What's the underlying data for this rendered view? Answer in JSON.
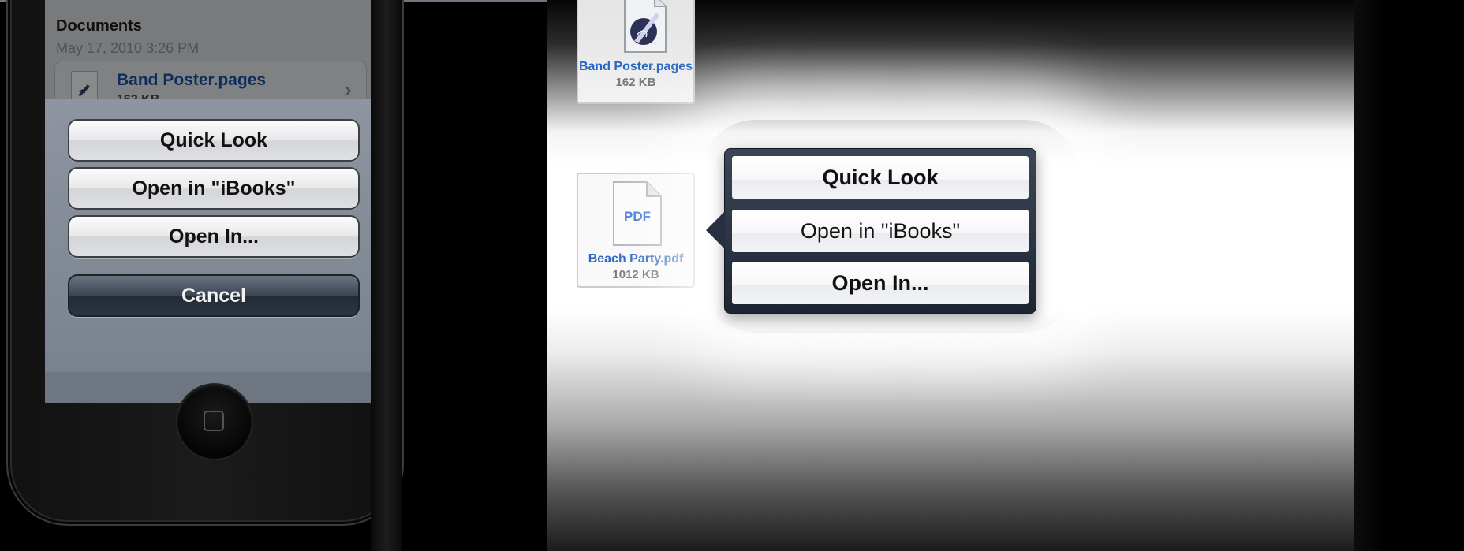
{
  "iphone": {
    "section_title": "Documents",
    "section_date": "May 17, 2010 3:26 PM",
    "file_row": {
      "name": "Band Poster.pages",
      "size": "162 KB",
      "icon": "pages-document-icon"
    },
    "action_sheet": {
      "quick_look": "Quick Look",
      "open_in_ibooks": "Open in \"iBooks\"",
      "open_in": "Open In...",
      "cancel": "Cancel"
    }
  },
  "ipad": {
    "files": [
      {
        "name": "Band Poster.pages",
        "size": "162 KB",
        "icon": "pages-document-icon"
      },
      {
        "name": "Beach Party.pdf",
        "size": "1012 KB",
        "icon": "pdf-document-icon",
        "badge": "PDF"
      }
    ],
    "popover": {
      "quick_look": "Quick Look",
      "open_in_ibooks": "Open in \"iBooks\"",
      "open_in": "Open In..."
    }
  },
  "colors": {
    "link_blue": "#2a67c5",
    "action_sheet_bg": "#828a96",
    "popover_frame": "#263042"
  }
}
